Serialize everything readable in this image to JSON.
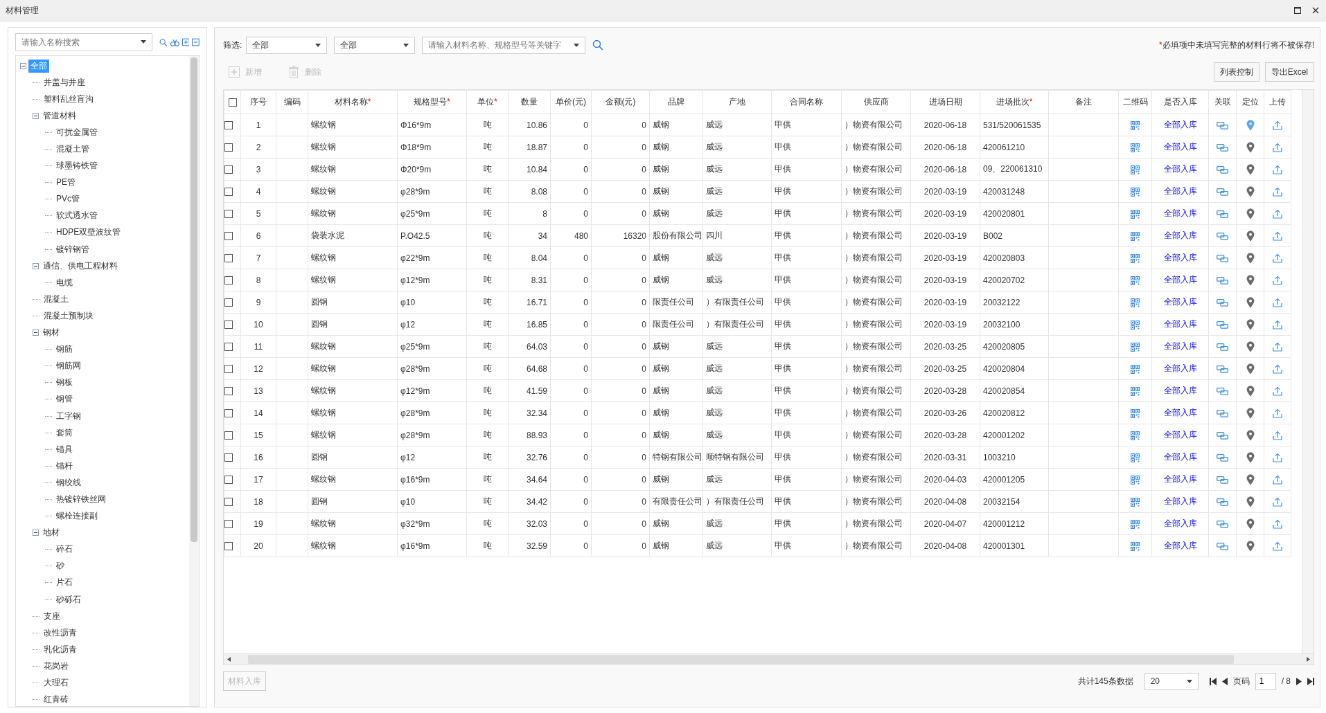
{
  "window": {
    "title": "材料管理"
  },
  "tree": {
    "search_placeholder": "请输入名称搜索",
    "nodes": [
      {
        "label": "全部",
        "selected": true,
        "expanded": true,
        "children": [
          {
            "label": "井盖与井座",
            "selected": false
          },
          {
            "label": "塑料乱丝盲沟",
            "selected": false
          },
          {
            "label": "管道材料",
            "selected": false,
            "expanded": true,
            "children": [
              {
                "label": "可扰金属管",
                "selected": false
              },
              {
                "label": "混凝土管",
                "selected": false
              },
              {
                "label": "球墨铸铁管",
                "selected": false
              },
              {
                "label": "PE管",
                "selected": false
              },
              {
                "label": "PVc管",
                "selected": false
              },
              {
                "label": "软式透水管",
                "selected": false
              },
              {
                "label": "HDPE双壁波纹管",
                "selected": false
              },
              {
                "label": "镀锌钢管",
                "selected": false
              }
            ]
          },
          {
            "label": "通信、供电工程材料",
            "selected": false,
            "expanded": true,
            "children": [
              {
                "label": "电缆",
                "selected": false
              }
            ]
          },
          {
            "label": "混凝土",
            "selected": false
          },
          {
            "label": "混凝土预制块",
            "selected": false
          },
          {
            "label": "钢材",
            "selected": false,
            "expanded": true,
            "children": [
              {
                "label": "钢筋",
                "selected": false
              },
              {
                "label": "钢筋网",
                "selected": false
              },
              {
                "label": "钢板",
                "selected": false
              },
              {
                "label": "钢管",
                "selected": false
              },
              {
                "label": "工字钢",
                "selected": false
              },
              {
                "label": "套筒",
                "selected": false
              },
              {
                "label": "锚具",
                "selected": false
              },
              {
                "label": "锚杆",
                "selected": false
              },
              {
                "label": "钢绞线",
                "selected": false
              },
              {
                "label": "热镀锌铁丝网",
                "selected": false
              },
              {
                "label": "螺栓连接副",
                "selected": false
              }
            ]
          },
          {
            "label": "地材",
            "selected": false,
            "expanded": true,
            "children": [
              {
                "label": "碎石",
                "selected": false
              },
              {
                "label": "砂",
                "selected": false
              },
              {
                "label": "片石",
                "selected": false
              },
              {
                "label": "砂砾石",
                "selected": false
              }
            ]
          },
          {
            "label": "支座",
            "selected": false
          },
          {
            "label": "改性沥青",
            "selected": false
          },
          {
            "label": "乳化沥青",
            "selected": false
          },
          {
            "label": "花岗岩",
            "selected": false
          },
          {
            "label": "大理石",
            "selected": false
          },
          {
            "label": "红青砖",
            "selected": false
          }
        ]
      }
    ]
  },
  "filter": {
    "label": "筛选:",
    "dropdowns": [
      "全部",
      "全部"
    ],
    "keyword_placeholder": "请输入材料名称、规格型号等关键字"
  },
  "notice": {
    "mark": "*",
    "text": "必填项中未填写完整的材料行将不被保存!"
  },
  "toolbar": [
    {
      "label": "新增",
      "kind": "add",
      "disabled": true
    },
    {
      "label": "删除",
      "kind": "delete",
      "disabled": true
    }
  ],
  "actions": [
    "列表控制",
    "导出Excel"
  ],
  "table": {
    "required_mark": "*",
    "select_all_checked": false,
    "columns": [
      {
        "label": "序号",
        "required": false
      },
      {
        "label": "编码",
        "required": false
      },
      {
        "label": "材料名称",
        "required": true
      },
      {
        "label": "规格型号",
        "required": true
      },
      {
        "label": "单位",
        "required": true
      },
      {
        "label": "数量",
        "required": false
      },
      {
        "label": "单价(元)",
        "required": false
      },
      {
        "label": "金额(元)",
        "required": false
      },
      {
        "label": "品牌",
        "required": false
      },
      {
        "label": "产地",
        "required": false
      },
      {
        "label": "合同名称",
        "required": false
      },
      {
        "label": "供应商",
        "required": false
      },
      {
        "label": "进场日期",
        "required": false
      },
      {
        "label": "进场批次",
        "required": true
      },
      {
        "label": "备注",
        "required": false
      },
      {
        "label": "二维码",
        "required": false
      },
      {
        "label": "是否入库",
        "required": false
      },
      {
        "label": "关联",
        "required": false
      },
      {
        "label": "定位",
        "required": false
      },
      {
        "label": "上传",
        "required": false
      }
    ],
    "rows": [
      {
        "checked": false,
        "cells": [
          "1",
          "",
          "螺纹钢",
          "Φ16*9m",
          "吨",
          "10.86",
          "0",
          "0",
          "威钢",
          "威远",
          "甲供",
          "）物资有限公司",
          "2020-06-18",
          "531/520061535",
          "",
          "全部入库"
        ],
        "located": true
      },
      {
        "checked": false,
        "cells": [
          "2",
          "",
          "螺纹钢",
          "Φ18*9m",
          "吨",
          "18.87",
          "0",
          "0",
          "威钢",
          "威远",
          "甲供",
          "）物资有限公司",
          "2020-06-18",
          "420061210",
          "",
          "全部入库"
        ],
        "located": false
      },
      {
        "checked": false,
        "cells": [
          "3",
          "",
          "螺纹钢",
          "Φ20*9m",
          "吨",
          "10.84",
          "0",
          "0",
          "威钢",
          "威远",
          "甲供",
          "）物资有限公司",
          "2020-06-18",
          "09、220061310",
          "",
          "全部入库"
        ],
        "located": false
      },
      {
        "checked": false,
        "cells": [
          "4",
          "",
          "螺纹钢",
          "φ28*9m",
          "吨",
          "8.08",
          "0",
          "0",
          "威钢",
          "威远",
          "甲供",
          "）物资有限公司",
          "2020-03-19",
          "420031248",
          "",
          "全部入库"
        ],
        "located": false
      },
      {
        "checked": false,
        "cells": [
          "5",
          "",
          "螺纹钢",
          "φ25*9m",
          "吨",
          "8",
          "0",
          "0",
          "威钢",
          "威远",
          "甲供",
          "）物资有限公司",
          "2020-03-19",
          "420020801",
          "",
          "全部入库"
        ],
        "located": false
      },
      {
        "checked": false,
        "cells": [
          "6",
          "",
          "袋装水泥",
          "P.O42.5",
          "吨",
          "34",
          "480",
          "16320",
          "股份有限公司",
          "四川",
          "甲供",
          "）物资有限公司",
          "2020-03-19",
          "B002",
          "",
          "全部入库"
        ],
        "located": false
      },
      {
        "checked": false,
        "cells": [
          "7",
          "",
          "螺纹钢",
          "φ22*9m",
          "吨",
          "8.04",
          "0",
          "0",
          "威钢",
          "威远",
          "甲供",
          "）物资有限公司",
          "2020-03-19",
          "420020803",
          "",
          "全部入库"
        ],
        "located": false
      },
      {
        "checked": false,
        "cells": [
          "8",
          "",
          "螺纹钢",
          "φ12*9m",
          "吨",
          "8.31",
          "0",
          "0",
          "威钢",
          "威远",
          "甲供",
          "）物资有限公司",
          "2020-03-19",
          "420020702",
          "",
          "全部入库"
        ],
        "located": false
      },
      {
        "checked": false,
        "cells": [
          "9",
          "",
          "圆钢",
          "φ10",
          "吨",
          "16.71",
          "0",
          "0",
          "限责任公司",
          "）有限责任公司",
          "甲供",
          "）物资有限公司",
          "2020-03-19",
          "20032122",
          "",
          "全部入库"
        ],
        "located": false
      },
      {
        "checked": false,
        "cells": [
          "10",
          "",
          "圆钢",
          "φ12",
          "吨",
          "16.85",
          "0",
          "0",
          "限责任公司",
          "）有限责任公司",
          "甲供",
          "）物资有限公司",
          "2020-03-19",
          "20032100",
          "",
          "全部入库"
        ],
        "located": false
      },
      {
        "checked": false,
        "cells": [
          "11",
          "",
          "螺纹钢",
          "φ25*9m",
          "吨",
          "64.03",
          "0",
          "0",
          "威钢",
          "威远",
          "甲供",
          "）物资有限公司",
          "2020-03-25",
          "420020805",
          "",
          "全部入库"
        ],
        "located": false
      },
      {
        "checked": false,
        "cells": [
          "12",
          "",
          "螺纹钢",
          "φ28*9m",
          "吨",
          "64.68",
          "0",
          "0",
          "威钢",
          "威远",
          "甲供",
          "）物资有限公司",
          "2020-03-25",
          "420020804",
          "",
          "全部入库"
        ],
        "located": false
      },
      {
        "checked": false,
        "cells": [
          "13",
          "",
          "螺纹钢",
          "φ12*9m",
          "吨",
          "41.59",
          "0",
          "0",
          "威钢",
          "威远",
          "甲供",
          "）物资有限公司",
          "2020-03-28",
          "420020854",
          "",
          "全部入库"
        ],
        "located": false
      },
      {
        "checked": false,
        "cells": [
          "14",
          "",
          "螺纹钢",
          "φ28*9m",
          "吨",
          "32.34",
          "0",
          "0",
          "威钢",
          "威远",
          "甲供",
          "）物资有限公司",
          "2020-03-26",
          "420020812",
          "",
          "全部入库"
        ],
        "located": false
      },
      {
        "checked": false,
        "cells": [
          "15",
          "",
          "螺纹钢",
          "φ28*9m",
          "吨",
          "88.93",
          "0",
          "0",
          "威钢",
          "威远",
          "甲供",
          "）物资有限公司",
          "2020-03-28",
          "420001202",
          "",
          "全部入库"
        ],
        "located": false
      },
      {
        "checked": false,
        "cells": [
          "16",
          "",
          "圆钢",
          "φ12",
          "吨",
          "32.76",
          "0",
          "0",
          "特钢有限公司",
          "顺特钢有限公司",
          "甲供",
          "）物资有限公司",
          "2020-03-31",
          "1003210",
          "",
          "全部入库"
        ],
        "located": false
      },
      {
        "checked": false,
        "cells": [
          "17",
          "",
          "螺纹钢",
          "φ16*9m",
          "吨",
          "34.64",
          "0",
          "0",
          "威钢",
          "威远",
          "甲供",
          "）物资有限公司",
          "2020-04-03",
          "420001205",
          "",
          "全部入库"
        ],
        "located": false
      },
      {
        "checked": false,
        "cells": [
          "18",
          "",
          "圆钢",
          "φ10",
          "吨",
          "34.42",
          "0",
          "0",
          "有限责任公司",
          "）有限责任公司",
          "甲供",
          "）物资有限公司",
          "2020-04-08",
          "20032154",
          "",
          "全部入库"
        ],
        "located": false
      },
      {
        "checked": false,
        "cells": [
          "19",
          "",
          "螺纹钢",
          "φ32*9m",
          "吨",
          "32.03",
          "0",
          "0",
          "威钢",
          "威远",
          "甲供",
          "）物资有限公司",
          "2020-04-07",
          "420001212",
          "",
          "全部入库"
        ],
        "located": false
      },
      {
        "checked": false,
        "cells": [
          "20",
          "",
          "螺纹钢",
          "φ16*9m",
          "吨",
          "32.59",
          "0",
          "0",
          "威钢",
          "威远",
          "甲供",
          "）物资有限公司",
          "2020-04-08",
          "420001301",
          "",
          "全部入库"
        ],
        "located": false
      }
    ]
  },
  "footer": {
    "stock_in_button": {
      "label": "材料入库",
      "disabled": true
    },
    "total": "共计145条数据",
    "page_size": "20",
    "page_label": "页码",
    "page": "1",
    "page_count": "/ 8"
  }
}
